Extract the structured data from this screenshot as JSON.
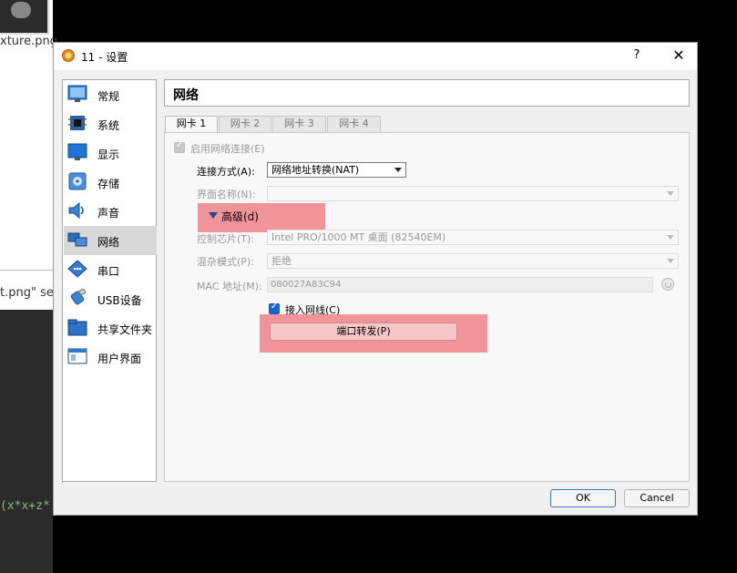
{
  "background": {
    "filename_fragment": "xture.png",
    "save_fragment": "t.png\" se",
    "code_fragment": "(x*x+z*"
  },
  "dialog": {
    "title": "11 - 设置",
    "help": "?",
    "close": "✕"
  },
  "sidebar": {
    "items": [
      {
        "label": "常规",
        "icon": "general-icon"
      },
      {
        "label": "系统",
        "icon": "system-chip-icon"
      },
      {
        "label": "显示",
        "icon": "display-monitor-icon"
      },
      {
        "label": "存储",
        "icon": "storage-disk-icon"
      },
      {
        "label": "声音",
        "icon": "speaker-icon"
      },
      {
        "label": "网络",
        "icon": "network-icon"
      },
      {
        "label": "串口",
        "icon": "serial-port-icon"
      },
      {
        "label": "USB设备",
        "icon": "usb-icon"
      },
      {
        "label": "共享文件夹",
        "icon": "shared-folder-icon"
      },
      {
        "label": "用户界面",
        "icon": "user-interface-icon"
      }
    ],
    "selected_index": 5
  },
  "content": {
    "title": "网络",
    "tabs": [
      "网卡 1",
      "网卡 2",
      "网卡 3",
      "网卡 4"
    ],
    "active_tab": 0,
    "enable_label": "启用网络连接(E)",
    "attach_label": "连接方式(A):",
    "attach_value": "网络地址转换(NAT)",
    "name_label": "界面名称(N):",
    "name_value": "",
    "advanced_label": "高级(d)",
    "adapter_label": "控制芯片(T):",
    "adapter_value": "Intel PRO/1000 MT 桌面 (82540EM)",
    "promisc_label": "混杂模式(P):",
    "promisc_value": "拒绝",
    "mac_label": "MAC 地址(M):",
    "mac_value": "080027A83C94",
    "cable_label": "接入网线(C)",
    "port_forward_label": "端口转发(P)"
  },
  "footer": {
    "ok": "OK",
    "cancel": "Cancel"
  },
  "colors": {
    "highlight": "#f0888e",
    "accent": "#1c64d2"
  }
}
